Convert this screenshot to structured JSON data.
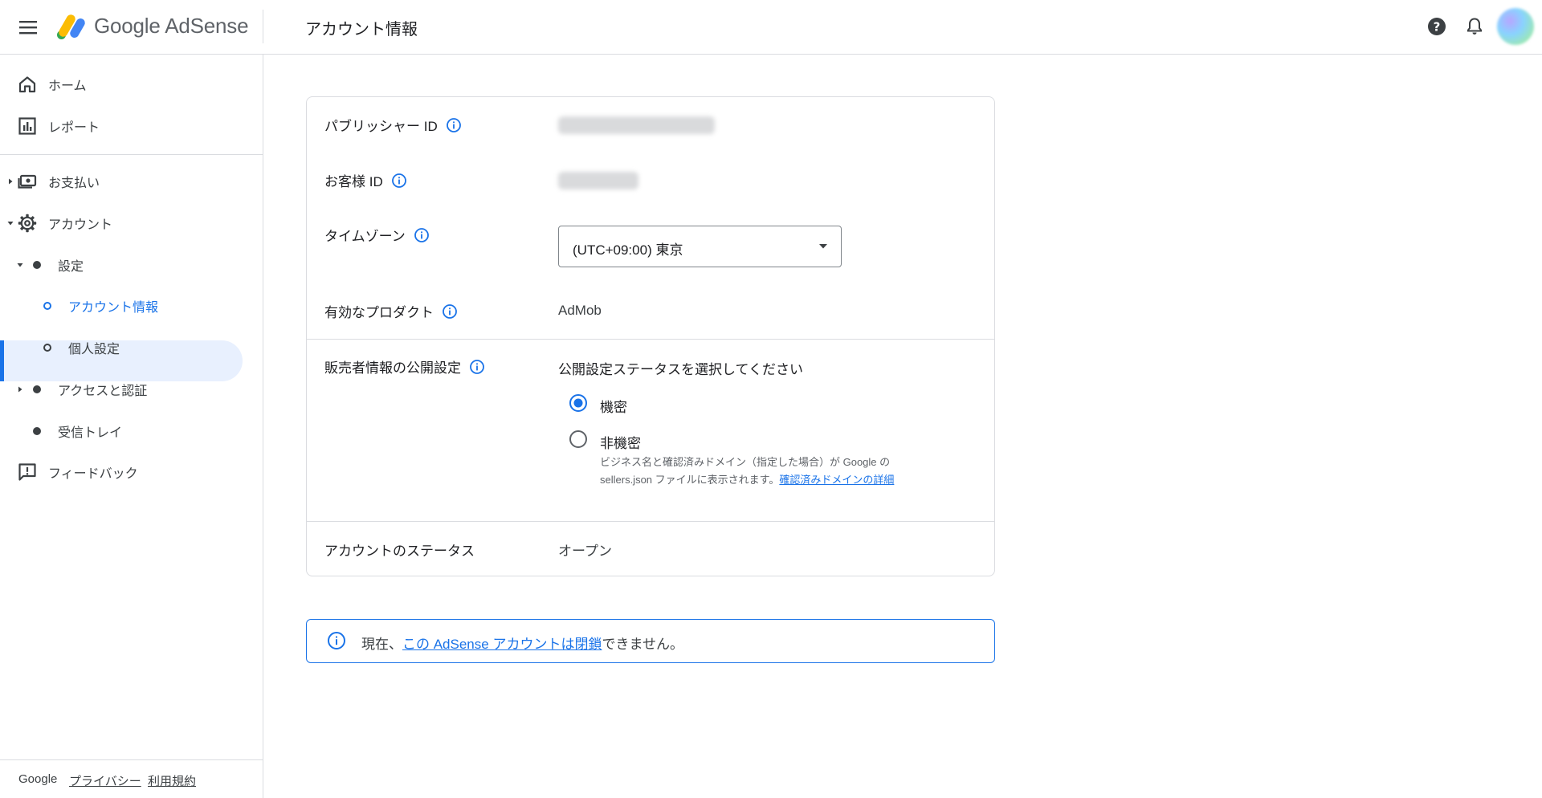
{
  "header": {
    "product_name": "Google AdSense",
    "page_title": "アカウント情報",
    "menu_icon": "menu-icon",
    "help_icon": "help-icon",
    "notifications_icon": "bell-icon"
  },
  "sidebar": {
    "items": [
      {
        "label": "ホーム",
        "icon": "home-icon"
      },
      {
        "label": "レポート",
        "icon": "report-icon"
      },
      {
        "label": "お支払い",
        "icon": "payments-icon"
      },
      {
        "label": "アカウント",
        "icon": "gear-icon"
      },
      {
        "label": "設定"
      },
      {
        "label": "アカウント情報",
        "active": true
      },
      {
        "label": "個人設定"
      },
      {
        "label": "アクセスと認証"
      },
      {
        "label": "受信トレイ"
      },
      {
        "label": "フィードバック",
        "icon": "feedback-icon"
      }
    ],
    "footer": {
      "brand": "Google",
      "privacy": "プライバシー",
      "terms": "利用規約"
    }
  },
  "account_info": {
    "publisher_id_label": "パブリッシャー ID",
    "customer_id_label": "お客様 ID",
    "timezone_label": "タイムゾーン",
    "timezone_value": "(UTC+09:00) 東京",
    "active_products_label": "有効なプロダクト",
    "active_products_value": "AdMob",
    "seller_info_label": "販売者情報の公開設定",
    "seller_info_prompt": "公開設定ステータスを選択してください",
    "options": [
      {
        "label": "機密",
        "selected": true
      },
      {
        "label": "非機密",
        "selected": false
      }
    ],
    "helper_line1": "ビジネス名と確認済みドメイン（指定した場合）が Google の",
    "helper_line2": "sellers.json ファイルに表示されます。",
    "helper_link": "確認済みドメインの詳細",
    "account_status_label": "アカウントのステータス",
    "account_status_value": "オープン"
  },
  "notice": {
    "prefix": "現在、",
    "link": "この AdSense アカウントは閉鎖",
    "suffix": "できません。"
  },
  "colors": {
    "accent": "#1a73e8",
    "active_bg": "#e8f0fe",
    "divider": "#dadce0"
  }
}
